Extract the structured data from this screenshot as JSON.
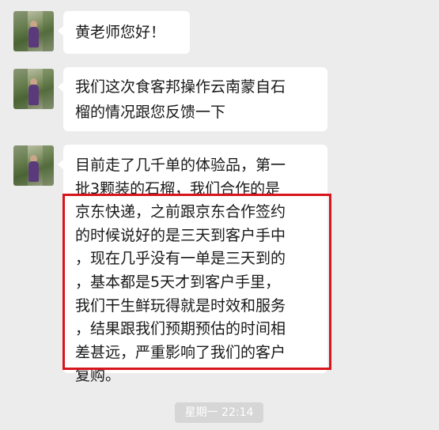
{
  "messages": [
    {
      "sender": "contact",
      "lines": [
        "黄老师您好！"
      ]
    },
    {
      "sender": "contact",
      "lines": [
        "我们这次食客邦操作云南蒙自石",
        "榴的情况跟您反馈一下"
      ]
    },
    {
      "sender": "contact",
      "lines": [
        "目前走了几千单的体验品，第一",
        "批3颗装的石榴，我们合作的是",
        "京东快递，之前跟京东合作签约",
        "的时候说好的是三天到客户手中",
        "，现在几乎没有一单是三天到的",
        "，基本都是5天才到客户手里，",
        "我们干生鲜玩得就是时效和服务",
        "，结果跟我们预期预估的时间相",
        "差甚远，严重影响了我们的客户",
        "复购。"
      ]
    }
  ],
  "timestamp": "星期一 22:14",
  "highlight_color": "#d8141c",
  "bubble_color": "#ffffff",
  "background_color": "#ececec"
}
